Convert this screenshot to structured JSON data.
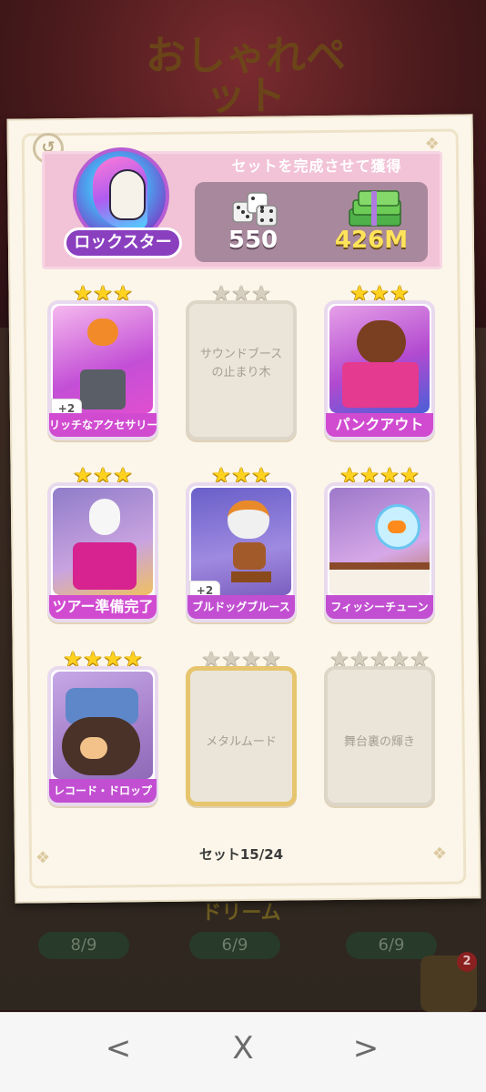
{
  "background": {
    "title": "おしゃれペット",
    "banner_middle": "ドリーム",
    "progress_left": "8/9",
    "progress_middle": "6/9",
    "progress_right": "6/9",
    "badge_count": "2"
  },
  "card": {
    "set_name": "ロックスター",
    "reward_caption": "セットを完成させて獲得",
    "reward_dice": "550",
    "reward_cash": "426M",
    "progress": "セット15/24"
  },
  "stickers": [
    {
      "label": "リッチなアクセサリー",
      "stars": 3,
      "collected": true,
      "extra": "+2",
      "label_color": "#d14bd1"
    },
    {
      "label": "サウンドブースの止まり木",
      "stars": 3,
      "collected": false
    },
    {
      "label": "パンクアウト",
      "stars": 3,
      "collected": true,
      "label_color": "#d14bd1"
    },
    {
      "label": "ツアー準備完了",
      "stars": 3,
      "collected": true,
      "label_color": "#d14bd1"
    },
    {
      "label": "ブルドッグブルース",
      "stars": 3,
      "collected": true,
      "extra": "+2",
      "label_color": "#c24fd2"
    },
    {
      "label": "フィッシーチューン",
      "stars": 4,
      "collected": true,
      "label_color": "#c24fd2"
    },
    {
      "label": "レコード・ドロップ",
      "stars": 4,
      "collected": true,
      "label_color": "#c24fd2"
    },
    {
      "label": "メタルムード",
      "stars": 4,
      "collected": false,
      "gold": true
    },
    {
      "label": "舞台裏の輝き",
      "stars": 5,
      "collected": false
    }
  ],
  "nav": {
    "prev": "<",
    "close": "X",
    "next": ">"
  },
  "colors": {
    "header_pink": "#f2c3d6",
    "label_purple": "#c24fd2",
    "gold_star": "#ffd21f"
  }
}
